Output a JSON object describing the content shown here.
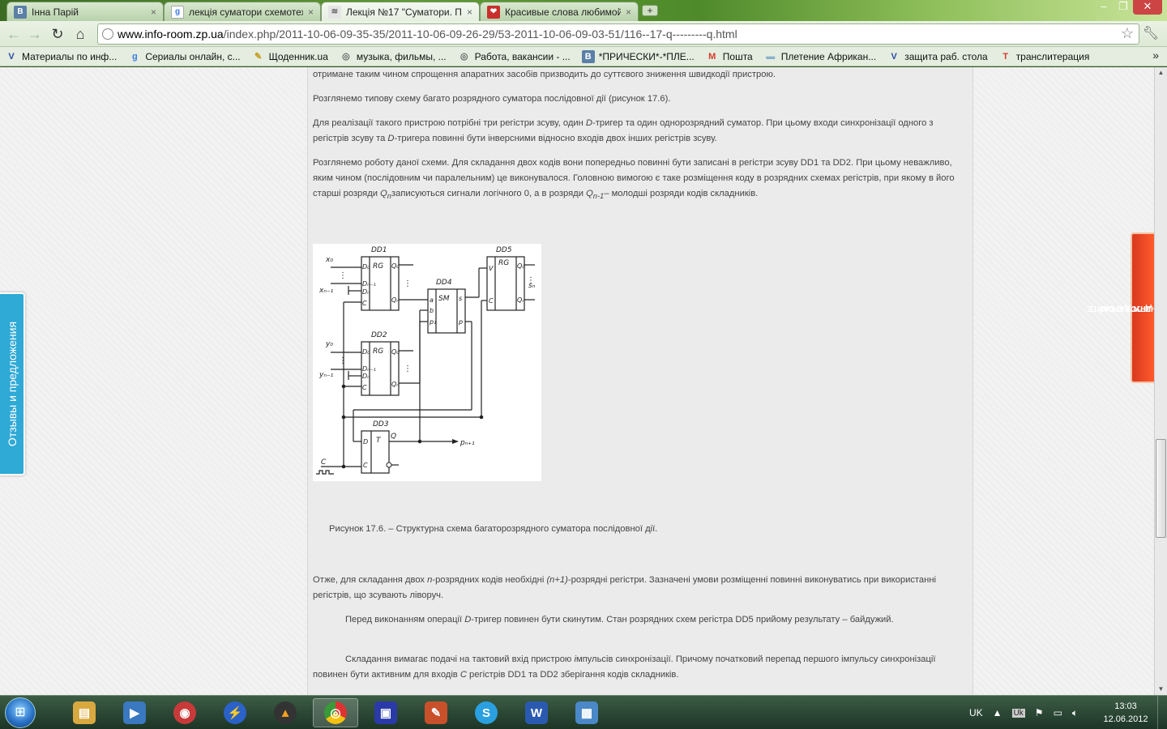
{
  "browser": {
    "tabs": [
      {
        "label": "Інна Парій",
        "favicon": "В",
        "color": "#5b7fa6"
      },
      {
        "label": "лекція суматори схемотех",
        "favicon": "g",
        "color": "#3a7be0"
      },
      {
        "label": "Лекція №17 \"Суматори. П",
        "favicon": "≋",
        "color": "#888888"
      },
      {
        "label": "Красивые слова любимой",
        "favicon": "❤",
        "color": "#c8302c"
      }
    ],
    "new_tab": "+",
    "url_host": "www.info-room.zp.ua",
    "url_path": "/index.php/2011-10-06-09-35-35/2011-10-06-09-26-29/53-2011-10-06-09-03-51/116--17-q---------q.html"
  },
  "bookmarks": [
    {
      "label": "Материалы по инф...",
      "icon": "V",
      "color": "#2a4aa8"
    },
    {
      "label": "Сериалы онлайн, с...",
      "icon": "g",
      "color": "#3a7be0"
    },
    {
      "label": "Щоденник.ua",
      "icon": "✎",
      "color": "#c49a1a"
    },
    {
      "label": "музыка, фильмы, ...",
      "icon": "◎",
      "color": "#666666"
    },
    {
      "label": "Работа, вакансии - ...",
      "icon": "◎",
      "color": "#666666"
    },
    {
      "label": "*ПРИЧЕСКИ*-*ПЛЕ...",
      "icon": "В",
      "color": "#5b7fa6"
    },
    {
      "label": "Пошта",
      "icon": "M",
      "color": "#d53b30"
    },
    {
      "label": "Плетение Африкан...",
      "icon": "▬",
      "color": "#8ab0cc"
    },
    {
      "label": "защита раб. стола",
      "icon": "V",
      "color": "#2a4aa8"
    },
    {
      "label": "транслитерация",
      "icon": "T",
      "color": "#d53b30"
    }
  ],
  "article": {
    "p0": "отримане таким чином спрощення апаратних засобів призводить до суттєвого зниження швидкодії пристрою.",
    "p1": "Розглянемо типову схему багато розрядного суматора послідовної дії (рисунок 17.6).",
    "p2a": "Для реалізації такого пристрою потрібні три регістри зсуву, один ",
    "p2b": "D",
    "p2c": "-тригер та один однорозрядний суматор. При цьому входи синхронізації одного з регістрів зсуву та ",
    "p2d": "D",
    "p2e": "-тригера повинні бути інверсними відносно входів двох інших регістрів зсуву.",
    "p3a": "Розглянемо роботу даної схеми. Для складання двох кодів вони попередньо повинні бути записані в регістри зсуву DD1 та DD2. При цьому неважливо, яким чином (послідовним чи паралельним) це виконувалося. Головною вимогою є таке розміщення коду в розрядних схемах регістрів, при якому в його старші розряди ",
    "p3b": "Q",
    "p3c": "n",
    "p3d": "записуються сигнали логічного 0, а в розряди ",
    "p3e": "Q",
    "p3f": "n-1",
    "p3g": "– молодші розряди кодів складників.",
    "caption": "Рисунок 17.6. – Структурна схема багаторозрядного суматора послідовної дії.",
    "p4a": "Отже, для складання двох ",
    "p4b": "n",
    "p4c": "-розрядних кодів необхідні ",
    "p4d": "(n+1)",
    "p4e": "-розрядні регістри. Зазначені умови розміщенні повинні виконуватись при використанні регістрів, що зсувають ліворуч.",
    "p5a": "Перед виконанням операції ",
    "p5b": "D",
    "p5c": "-тригер повинен бути скинутим. Стан розрядних схем регістра DD5 прийому результату – байдужий.",
    "p6a": "Складання вимагає подачі на тактовий вхід пристрою ",
    "p6b": "і",
    "p6c": "мпульсів синхронізації. Причому початковий перепад першого імпульсу синхронізації повинен бути активним для входів ",
    "p6d": "C",
    "p6e": " регістрів DD1 та DD2 зберігання кодів складників."
  },
  "figure_labels": {
    "dd1": "DD1",
    "dd2": "DD2",
    "dd3": "DD3",
    "dd4": "DD4",
    "dd5": "DD5",
    "rg": "RG",
    "sm": "SM",
    "t": "T",
    "x0": "x₀",
    "xn1": "xₙ₋₁",
    "y0": "y₀",
    "yn1": "yₙ₋₁",
    "sn": "sₙ",
    "pn1": "pₙ₊₁",
    "c": "C",
    "q": "Q",
    "d0": "D₀",
    "dn1": "Dₙ₋₁",
    "dn": "Dₙ",
    "q0": "Q₀",
    "qn": "Qₙ",
    "a": "a",
    "b": "b",
    "p1": "p₁",
    "s": "s",
    "p": "p",
    "v": "V",
    "d": "D"
  },
  "side_widgets": {
    "feedback": "Отзывы и предложения",
    "promo_line1": "РАССКАЖИ ДРУГУ О САЙТЕ",
    "promo_line2": "И ПОЛУЧИ ПОДАРОК!"
  },
  "taskbar": {
    "apps": [
      {
        "icon": "folder-icon",
        "color": "#d9a940",
        "glyph": "▤"
      },
      {
        "icon": "media-player-icon",
        "color": "#3a78c0",
        "glyph": "▶"
      },
      {
        "icon": "app-red-icon",
        "color": "#c83a3a",
        "glyph": "◉"
      },
      {
        "icon": "lightning-icon",
        "color": "#2a62c8",
        "glyph": "⚡"
      },
      {
        "icon": "warning-icon",
        "color": "#333333",
        "glyph": "▲"
      },
      {
        "icon": "chrome-icon",
        "color": "#3a9a3a",
        "glyph": "◎"
      },
      {
        "icon": "floppy-icon",
        "color": "#2a3aa8",
        "glyph": "▣"
      },
      {
        "icon": "paint-icon",
        "color": "#c8502a",
        "glyph": "✎"
      },
      {
        "icon": "skype-icon",
        "color": "#2aa0e0",
        "glyph": "S"
      },
      {
        "icon": "word-icon",
        "color": "#2a5ab0",
        "glyph": "W"
      },
      {
        "icon": "control-panel-icon",
        "color": "#4a88c8",
        "glyph": "▦"
      }
    ],
    "lang": "UK",
    "lang_badge": "Uk",
    "time": "13:03",
    "date": "12.06.2012"
  }
}
